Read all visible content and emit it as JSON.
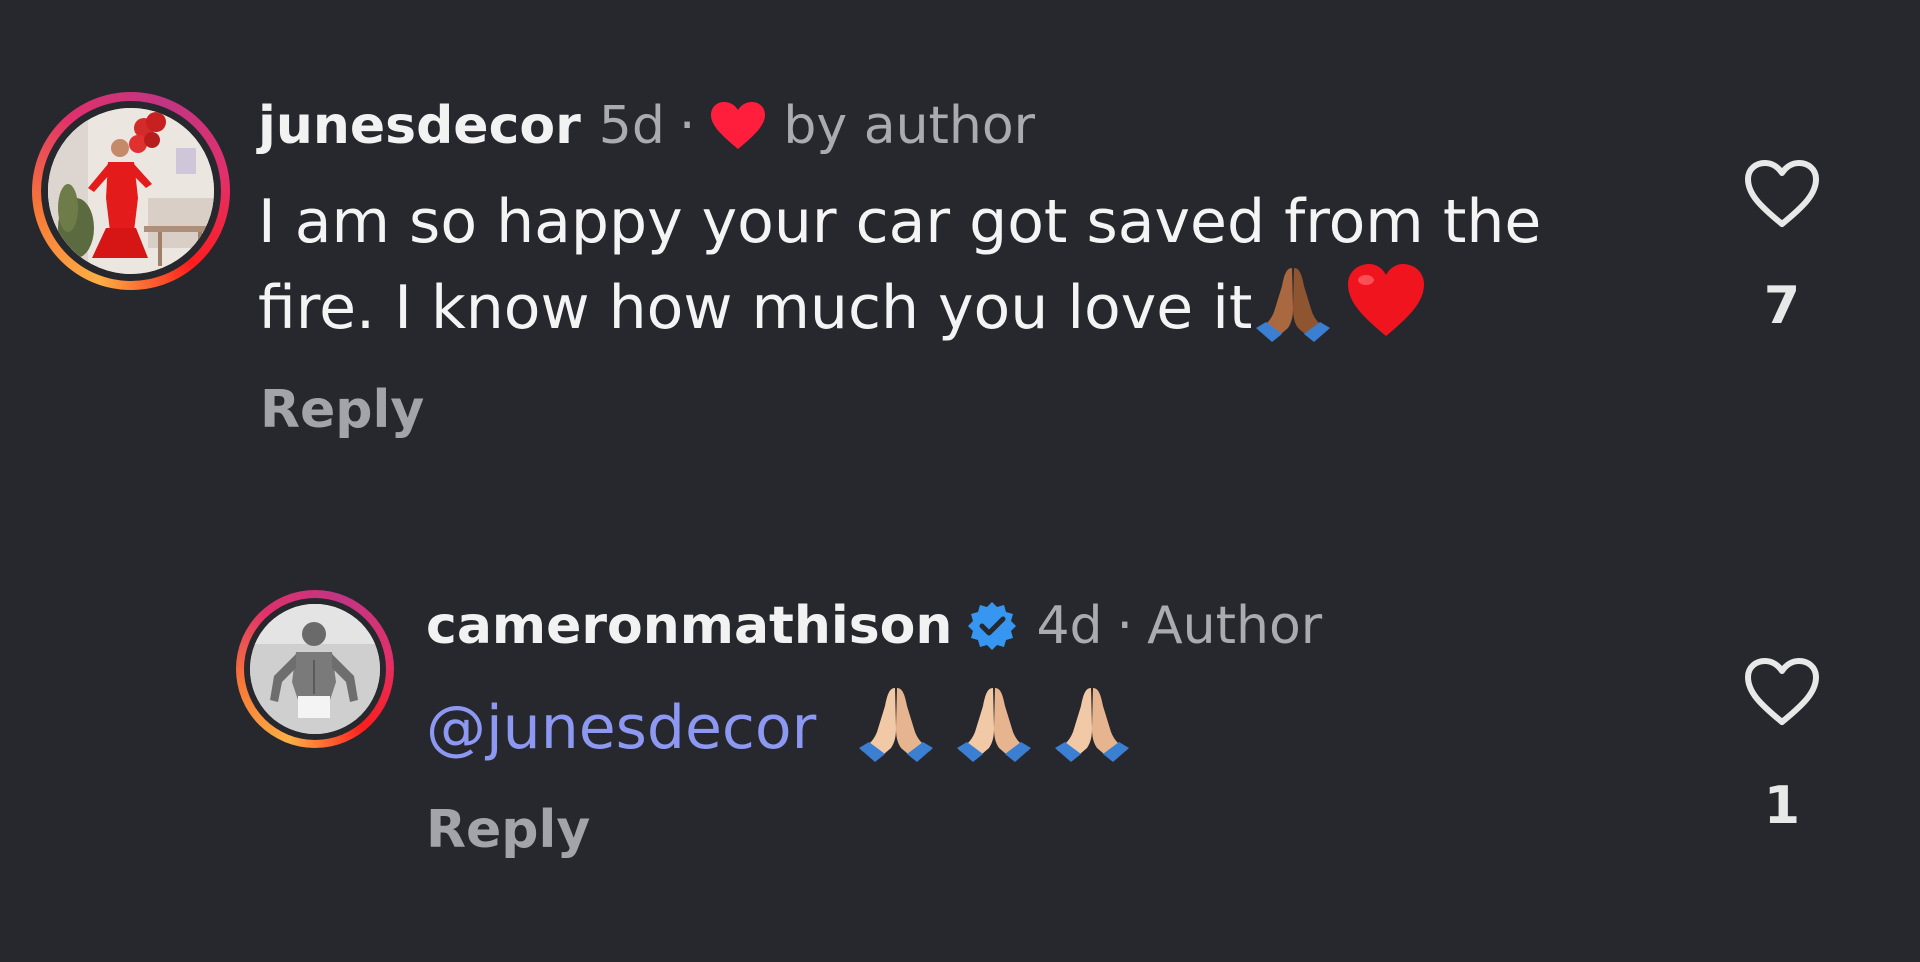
{
  "colors": {
    "background": "#26282d",
    "mention": "#8d98f2",
    "liked_heart": "#ff1f3d",
    "verified": "#3797f0",
    "muted_text": "#a9abb0"
  },
  "comments": [
    {
      "username": "junesdecor",
      "time": "5d",
      "separator": "·",
      "liked_by_author_icon": "red-heart-icon",
      "liked_by_author_text": "by author",
      "text": "I am so happy your car got saved from the fire. I know how much you love it",
      "text_line1": "I am so happy your car got saved from the",
      "text_line2": "fire. I know how much you love it",
      "emojis": [
        "folded-hands-medium-dark",
        "red-heart"
      ],
      "reply_label": "Reply",
      "like_count": "7"
    },
    {
      "username": "cameronmathison",
      "verified": true,
      "time": "4d",
      "separator": "·",
      "author_tag": "Author",
      "mention": "@junesdecor",
      "emojis": [
        "folded-hands-light",
        "folded-hands-light",
        "folded-hands-light"
      ],
      "reply_label": "Reply",
      "like_count": "1"
    }
  ]
}
